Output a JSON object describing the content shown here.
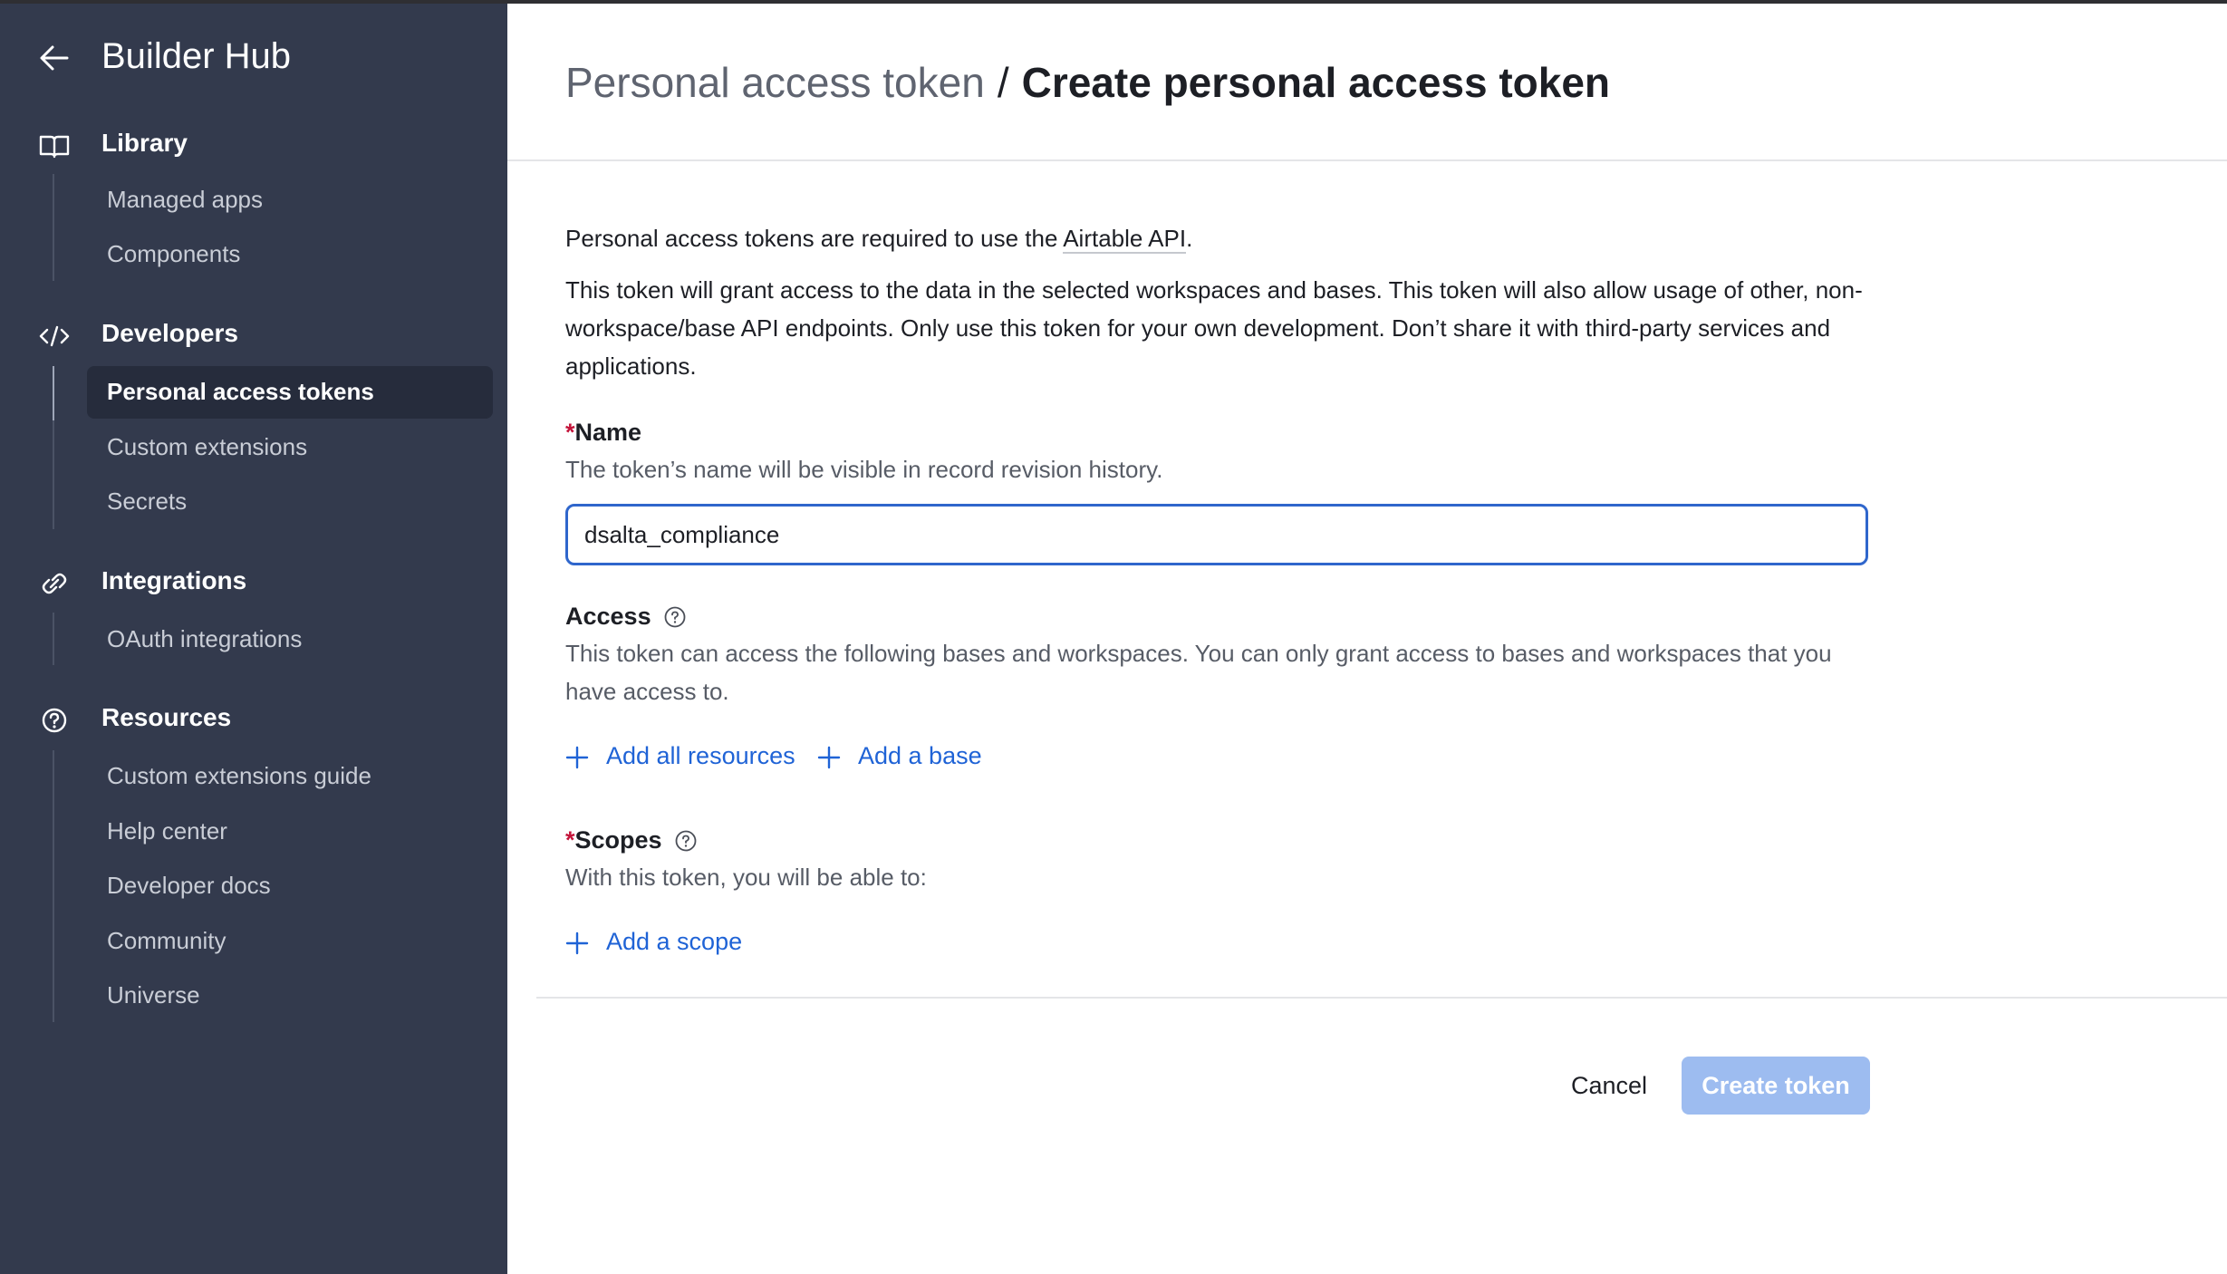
{
  "sidebar": {
    "title": "Builder Hub",
    "sections": {
      "library": {
        "label": "Library",
        "items": [
          "Managed apps",
          "Components"
        ]
      },
      "developers": {
        "label": "Developers",
        "items": [
          "Personal access tokens",
          "Custom extensions",
          "Secrets"
        ],
        "active_item": "Personal access tokens"
      },
      "integrations": {
        "label": "Integrations",
        "items": [
          "OAuth integrations"
        ]
      },
      "resources": {
        "label": "Resources",
        "items": [
          "Custom extensions guide",
          "Help center",
          "Developer docs",
          "Community",
          "Universe"
        ]
      }
    }
  },
  "breadcrumb": {
    "parent": "Personal access token",
    "separator": "/",
    "current": "Create personal access token"
  },
  "intro": {
    "line1_prefix": "Personal access tokens are required to use the ",
    "api_link": "Airtable API",
    "line1_suffix": ".",
    "paragraph": "This token will grant access to the data in the selected workspaces and bases. This token will also allow usage of other, non-workspace/base API endpoints. Only use this token for your own development. Don’t share it with third-party services and applications."
  },
  "name_field": {
    "required_marker": "*",
    "label": "Name",
    "help": "The token’s name will be visible in record revision history.",
    "value": "dsalta_compliance"
  },
  "access": {
    "label": "Access",
    "help": "This token can access the following bases and workspaces. You can only grant access to bases and workspaces that you have access to.",
    "add_all_label": "Add all resources",
    "add_base_label": "Add a base"
  },
  "scopes": {
    "required_marker": "*",
    "label": "Scopes",
    "help": "With this token, you will be able to:",
    "add_scope_label": "Add a scope"
  },
  "footer": {
    "cancel_label": "Cancel",
    "create_label": "Create token"
  },
  "colors": {
    "sidebar_bg": "#333a4d",
    "active_item_bg": "#262c3c",
    "link_blue": "#1f63d6",
    "input_focus": "#2f66cc",
    "create_disabled": "#9dbcf0",
    "required_red": "#c4143a"
  },
  "icons": {
    "back": "arrow-left-icon",
    "library": "book-open-icon",
    "developers": "code-icon",
    "integrations": "link-icon",
    "resources": "help-circle-icon",
    "help": "question-circle-icon",
    "add": "plus-icon"
  }
}
